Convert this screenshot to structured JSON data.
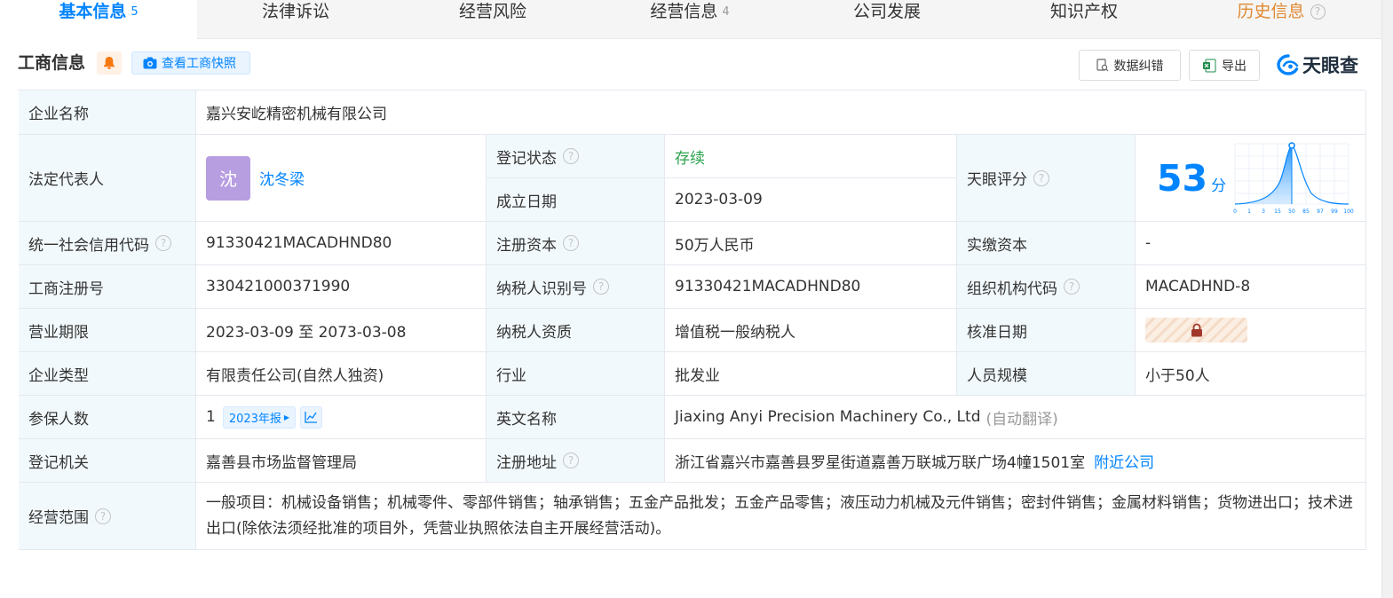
{
  "tabs": [
    {
      "label": "基本信息",
      "count": "5"
    },
    {
      "label": "法律诉讼",
      "count": ""
    },
    {
      "label": "经营风险",
      "count": ""
    },
    {
      "label": "经营信息",
      "count": "4"
    },
    {
      "label": "公司发展",
      "count": ""
    },
    {
      "label": "知识产权",
      "count": ""
    },
    {
      "label": "历史信息",
      "count": ""
    }
  ],
  "section": {
    "title": "工商信息",
    "snapshot_label": "查看工商快照",
    "correct_label": "数据纠错",
    "export_label": "导出",
    "logo_text": "天眼查"
  },
  "info": {
    "company_name_label": "企业名称",
    "company_name": "嘉兴安屹精密机械有限公司",
    "legal_rep_label": "法定代表人",
    "legal_rep_avatar": "沈",
    "legal_rep": "沈冬梁",
    "reg_status_label": "登记状态",
    "reg_status": "存续",
    "founded_label": "成立日期",
    "founded": "2023-03-09",
    "tianyan_score_label": "天眼评分",
    "tianyan_score": "53",
    "tianyan_score_unit": "分",
    "score_axis": [
      "0",
      "1",
      "3",
      "15",
      "50",
      "85",
      "97",
      "99",
      "100"
    ],
    "credit_code_label": "统一社会信用代码",
    "credit_code": "91330421MACADHND80",
    "reg_capital_label": "注册资本",
    "reg_capital": "50万人民币",
    "paid_capital_label": "实缴资本",
    "paid_capital": "-",
    "reg_no_label": "工商注册号",
    "reg_no": "330421000371990",
    "taxpayer_id_label": "纳税人识别号",
    "taxpayer_id": "91330421MACADHND80",
    "org_code_label": "组织机构代码",
    "org_code": "MACADHND-8",
    "term_label": "营业期限",
    "term": "2023-03-09 至 2073-03-08",
    "taxpayer_type_label": "纳税人资质",
    "taxpayer_type": "增值税一般纳税人",
    "approval_date_label": "核准日期",
    "company_type_label": "企业类型",
    "company_type": "有限责任公司(自然人独资)",
    "industry_label": "行业",
    "industry": "批发业",
    "staff_size_label": "人员规模",
    "staff_size": "小于50人",
    "insured_label": "参保人数",
    "insured": "1",
    "insured_report": "2023年报",
    "english_name_label": "英文名称",
    "english_name": "Jiaxing Anyi Precision Machinery Co., Ltd",
    "english_name_note": "(自动翻译)",
    "authority_label": "登记机关",
    "authority": "嘉善县市场监督管理局",
    "address_label": "注册地址",
    "address": "浙江省嘉兴市嘉善县罗星街道嘉善万联城万联广场4幢1501室",
    "nearby_label": "附近公司",
    "scope_label": "经营范围",
    "scope": "一般项目：机械设备销售；机械零件、零部件销售；轴承销售；五金产品批发；五金产品零售；液压动力机械及元件销售；密封件销售；金属材料销售；货物进出口；技术进出口(除依法须经批准的项目外，凭营业执照依法自主开展经营活动)。"
  },
  "colors": {
    "accent": "#0084ff",
    "label_bg": "#f2f9fc",
    "status_green": "#2ba34d",
    "history_orange": "#e08a32"
  }
}
